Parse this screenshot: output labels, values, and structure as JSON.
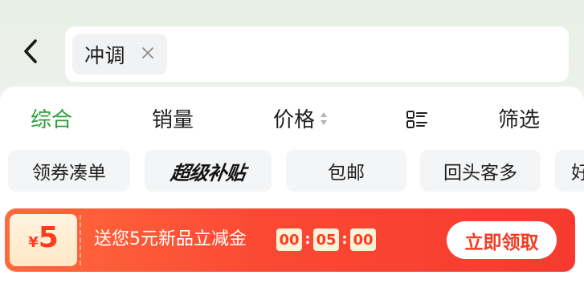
{
  "search": {
    "query_chip": "冲调"
  },
  "sort_tabs": {
    "comprehensive": "综合",
    "sales": "销量",
    "price": "价格",
    "filter": "筛选"
  },
  "quick_filters": {
    "chip_1": "领券凑单",
    "chip_2": "超级补贴",
    "chip_3": "包邮",
    "chip_4": "回头客多",
    "chip_5": "好"
  },
  "coupon": {
    "currency": "¥",
    "amount": "5",
    "text": "送您5元新品立减金",
    "countdown": {
      "hours": "00",
      "minutes": "05",
      "seconds": "00"
    },
    "claim_label": "立即领取"
  },
  "colors": {
    "active_tab": "#2e9e3c",
    "banner_red": "#fb4934",
    "coupon_accent": "#ff3b1f"
  },
  "icons": {
    "back": "chevron-left-icon",
    "clear": "close-icon",
    "price_sort": "sort-arrows-icon",
    "layout": "list-grid-icon"
  }
}
